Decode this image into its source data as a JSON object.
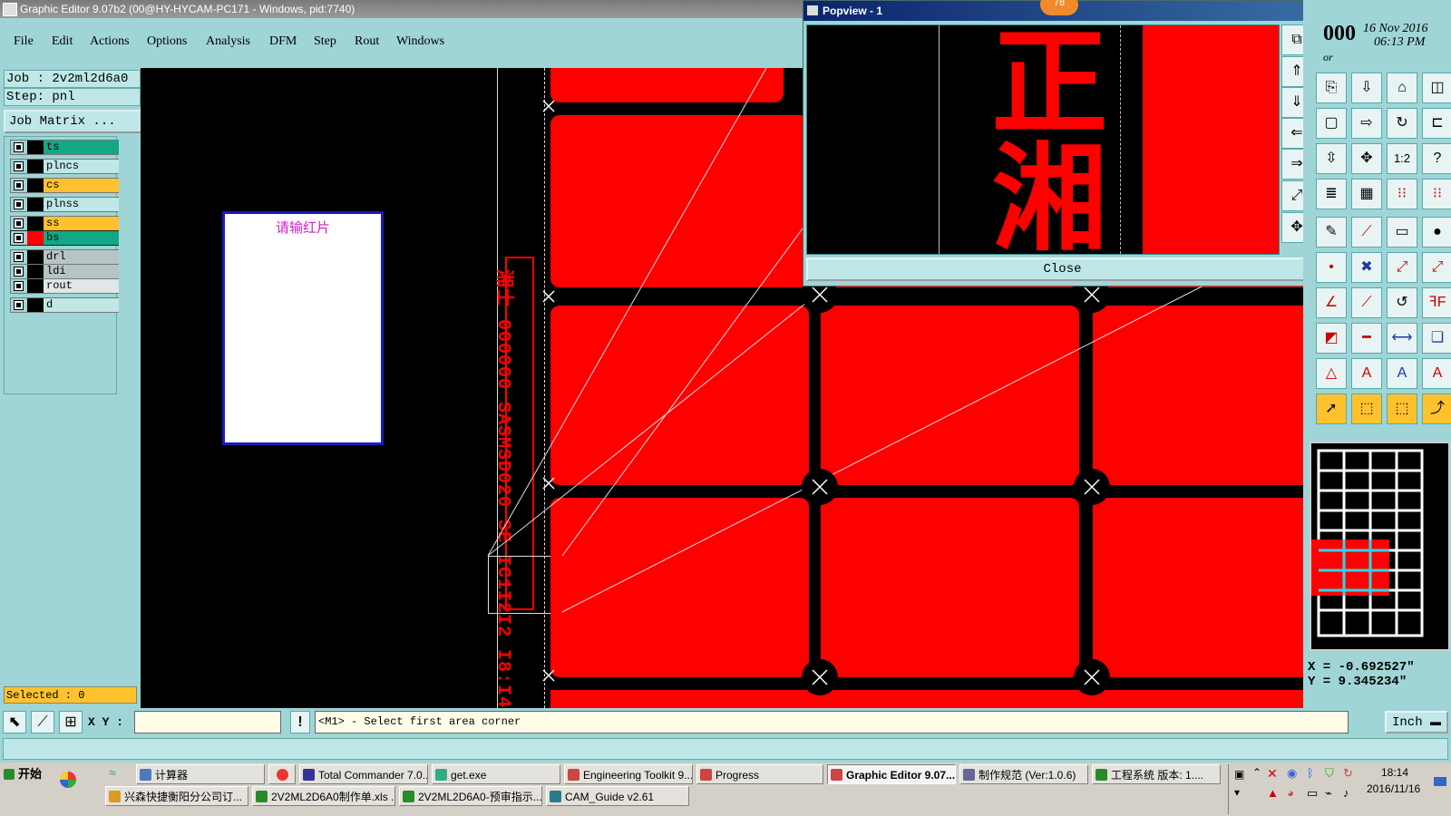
{
  "window": {
    "title": "Graphic Editor 9.07b2 (00@HY-HYCAM-PC171 - Windows, pid:7740)",
    "min_glyph": "_",
    "max_glyph": "❐",
    "close_glyph": "✕"
  },
  "menu": [
    "File",
    "Edit",
    "Actions",
    "Options",
    "Analysis",
    "DFM",
    "Step",
    "Rout",
    "Windows"
  ],
  "left": {
    "job_label": "Job : 2v2ml2d6a0",
    "step_label": "Step: pnl",
    "job_matrix_button": "Job Matrix ...",
    "layers": [
      {
        "name": "ts",
        "color": "#12a886"
      },
      {
        "name": "plncs",
        "color": "#bfe7e7"
      },
      {
        "name": "cs",
        "color": "#ffc22e"
      },
      {
        "name": "plnss",
        "color": "#bfe7e7"
      },
      {
        "name": "ss",
        "color": "#ffc22e"
      },
      {
        "name": "bs",
        "color": "#12a886",
        "active": true
      },
      {
        "name": "drl",
        "color": "#b7c4c6"
      },
      {
        "name": "ldi",
        "color": "#b7c4c6"
      },
      {
        "name": "rout",
        "color": "#dfe7e7"
      },
      {
        "name": "d",
        "color": "#bfe7e7"
      }
    ],
    "selected_label": "Selected : 0"
  },
  "canvas": {
    "note_text": "请输红片",
    "vertical_text": "湘士 000000 SASMSD020 SE IC1I2I2 I8:I4",
    "magnify_text": "湘"
  },
  "popview": {
    "title": "Popview - 1",
    "badge": "78",
    "close_button": "Close",
    "chars": "正湘"
  },
  "header_right": {
    "count": "000",
    "date": "16 Nov 2016",
    "time": "06:13 PM",
    "sub": "or"
  },
  "coords": {
    "x": "X = -0.692527\"",
    "y": "Y = 9.345234\""
  },
  "cmd": {
    "xy_label": "X Y :",
    "xy_value": "",
    "excl": "!",
    "message": "<M1> - Select first area corner",
    "unit": "Inch",
    "unit_arrow": "▬"
  },
  "taskbar": {
    "start": "开始",
    "row1": [
      "计算器",
      "Total Commander 7.0...",
      "get.exe",
      "Engineering Toolkit 9....",
      "Progress",
      "Graphic Editor 9.07...",
      "制作规范 (Ver:1.0.6)",
      "工程系统  版本: 1...."
    ],
    "row2": [
      "兴森快捷衡阳分公司订...",
      "2V2ML2D6A0制作单.xls ...",
      "2V2ML2D6A0-预审指示...",
      "CAM_Guide v2.61"
    ],
    "clock": "18:14",
    "date": "2016/11/16"
  },
  "tools": [
    "popview-zoom",
    "move-up",
    "move-down",
    "move-left",
    "move-right",
    "fit",
    "center",
    "home",
    "copy",
    "rotate",
    "ratio-1-2",
    "help",
    "grid",
    "snap",
    "ruler",
    "circle",
    "cross",
    "line",
    "arc",
    "font",
    "measure",
    "text",
    "select",
    "pointer"
  ],
  "colors": {
    "bg": "#9fd5d6",
    "red": "#ff0000",
    "accent": "#ffc22e"
  }
}
